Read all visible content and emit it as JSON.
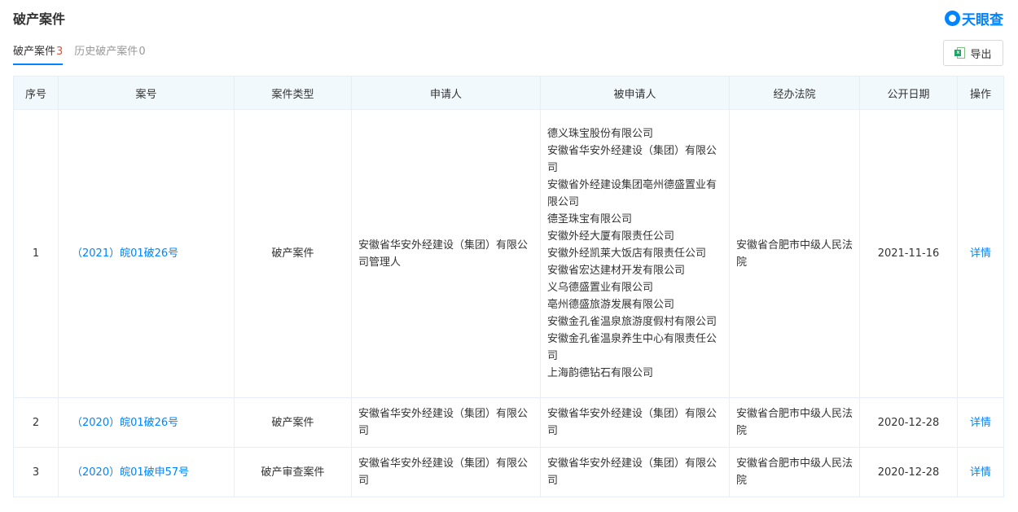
{
  "header": {
    "title": "破产案件",
    "logo_text": "天眼查"
  },
  "tabs": [
    {
      "label": "破产案件",
      "count": "3"
    },
    {
      "label": "历史破产案件",
      "count": "0"
    }
  ],
  "toolbar": {
    "export_label": "导出",
    "export_icon": "excel-icon",
    "export_icon_letter": "x"
  },
  "table": {
    "columns": [
      "序号",
      "案号",
      "案件类型",
      "申请人",
      "被申请人",
      "经办法院",
      "公开日期",
      "操作"
    ],
    "rows": [
      {
        "index": "1",
        "case_no": "（2021）皖01破26号",
        "type": "破产案件",
        "applicant": "安徽省华安外经建设（集团）有限公司管理人",
        "respondents": [
          "德义珠宝股份有限公司",
          "安徽省华安外经建设（集团）有限公司",
          "安徽省外经建设集团亳州德盛置业有限公司",
          "德圣珠宝有限公司",
          "安徽外经大厦有限责任公司",
          "安徽外经凯莱大饭店有限责任公司",
          "安徽省宏达建材开发有限公司",
          "义乌德盛置业有限公司",
          "亳州德盛旅游发展有限公司",
          "安徽金孔雀温泉旅游度假村有限公司",
          "安徽金孔雀温泉养生中心有限责任公司",
          "上海韵德钻石有限公司"
        ],
        "court": "安徽省合肥市中级人民法院",
        "date": "2021-11-16",
        "action": "详情"
      },
      {
        "index": "2",
        "case_no": "（2020）皖01破26号",
        "type": "破产案件",
        "applicant": "安徽省华安外经建设（集团）有限公司",
        "respondents": [
          "安徽省华安外经建设（集团）有限公司"
        ],
        "court": "安徽省合肥市中级人民法院",
        "date": "2020-12-28",
        "action": "详情"
      },
      {
        "index": "3",
        "case_no": "（2020）皖01破申57号",
        "type": "破产审查案件",
        "applicant": "安徽省华安外经建设（集团）有限公司",
        "respondents": [
          "安徽省华安外经建设（集团）有限公司"
        ],
        "court": "安徽省合肥市中级人民法院",
        "date": "2020-12-28",
        "action": "详情"
      }
    ]
  }
}
